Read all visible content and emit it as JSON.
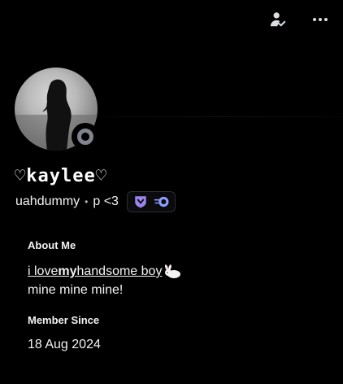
{
  "header": {
    "actions": [
      {
        "icon": "add-friend-check-icon"
      },
      {
        "icon": "more-options-icon"
      }
    ]
  },
  "profile": {
    "avatar_icon": "profile-avatar-silhouette",
    "status": "offline",
    "display_name": "♡kaylee♡",
    "username": "uahdummy",
    "separator": "•",
    "pronouns": "p <3",
    "badges": [
      {
        "icon": "hypesquad-balance-badge-icon",
        "color": "#9b84ec"
      },
      {
        "icon": "nitro-badge-icon",
        "color": "#8c9eff"
      }
    ]
  },
  "about": {
    "title": "About Me",
    "bio_line1_pre": "i love ",
    "bio_line1_bold": "my",
    "bio_line1_post": " handsome boy",
    "bio_emoji": "bunny-emoji",
    "bio_line2": "mine mine mine!"
  },
  "member_since": {
    "title": "Member Since",
    "date": "18 Aug 2024"
  }
}
